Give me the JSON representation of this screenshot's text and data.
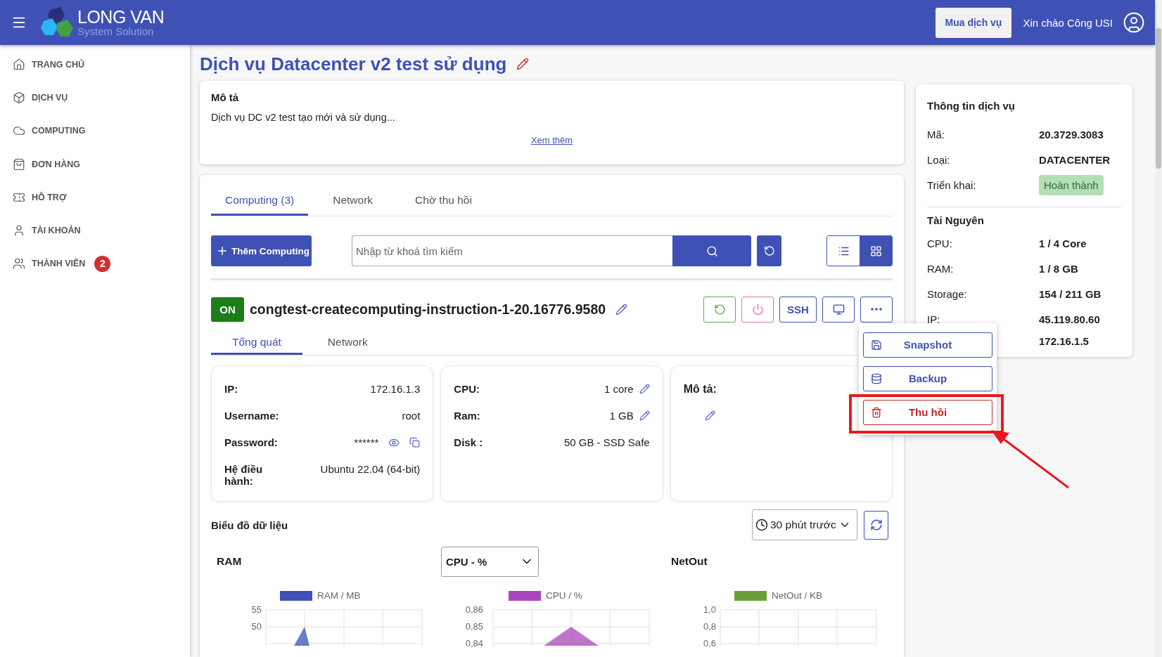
{
  "header": {
    "logo": {
      "name": "LONG VAN",
      "tagline": "System Solution"
    },
    "buy_button": "Mua dịch vụ",
    "greeting": "Xin chào Công USI"
  },
  "sidebar": {
    "items": [
      {
        "label": "TRANG CHỦ"
      },
      {
        "label": "DỊCH VỤ"
      },
      {
        "label": "COMPUTING"
      },
      {
        "label": "ĐƠN HÀNG"
      },
      {
        "label": "HỖ TRỢ"
      },
      {
        "label": "TÀI KHOẢN"
      },
      {
        "label": "THÀNH VIÊN",
        "badge": "2"
      }
    ]
  },
  "page": {
    "title": "Dịch vụ Datacenter v2 test sử dụng"
  },
  "description": {
    "heading": "Mô tả",
    "text": "Dịch vụ DC v2 test tạo mới và sử dụng...",
    "more_link": "Xem thêm"
  },
  "tabs": [
    {
      "label": "Computing (3)",
      "selected": true
    },
    {
      "label": "Network",
      "selected": false
    },
    {
      "label": "Chờ thu hồi",
      "selected": false
    }
  ],
  "toolbar": {
    "add_button": "Thêm Computing",
    "search": {
      "placeholder": "Nhập từ khoá tìm kiếm"
    },
    "view_modes": [
      {
        "kind": "list",
        "selected": false
      },
      {
        "kind": "grid",
        "selected": true
      }
    ]
  },
  "computing": {
    "status": "ON",
    "on": true,
    "name": "congtest-createcomputing-instruction-1-20.16776.9580",
    "actions": [
      {
        "kind": "restart"
      },
      {
        "kind": "power"
      },
      {
        "kind": "text",
        "label": "SSH"
      },
      {
        "kind": "console"
      },
      {
        "kind": "more"
      }
    ],
    "menu": {
      "open": true,
      "items": [
        {
          "kind": "snapshot",
          "label": "Snapshot",
          "highlighted": false
        },
        {
          "kind": "backup",
          "label": "Backup",
          "highlighted": false
        },
        {
          "kind": "revoke",
          "label": "Thu hồi",
          "highlighted": true
        }
      ]
    },
    "sub_tabs": [
      {
        "label": "Tổng quát",
        "selected": true
      },
      {
        "label": "Network",
        "selected": false
      }
    ],
    "cards": [
      {
        "kind": "fields",
        "rows": [
          {
            "kind": "plain",
            "label": "IP:",
            "value": "172.16.1.3"
          },
          {
            "kind": "plain",
            "label": "Username:",
            "value": "root"
          },
          {
            "kind": "secret",
            "label": "Password:",
            "value": "******"
          },
          {
            "kind": "plain",
            "label": "Hệ điều hành:",
            "value": "Ubuntu 22.04 (64-bit)"
          }
        ]
      },
      {
        "kind": "fields",
        "rows": [
          {
            "kind": "editable",
            "label": "CPU:",
            "value": "1 core"
          },
          {
            "kind": "editable",
            "label": "Ram:",
            "value": "1 GB"
          },
          {
            "kind": "plain",
            "label": "Disk :",
            "value": "50 GB - SSD Safe"
          }
        ]
      },
      {
        "kind": "note",
        "heading": "Mô tả:"
      }
    ]
  },
  "charts": {
    "title": "Biểu đồ dữ liệu",
    "range": "30 phút trước",
    "panels": [
      {
        "kind": "label",
        "title": "RAM",
        "legend": "RAM / MB",
        "color": "#3f51b5",
        "y_ticks": [
          "55",
          "50"
        ]
      },
      {
        "kind": "select",
        "title": "CPU - %",
        "legend": "CPU / %",
        "color": "#ab47bc",
        "y_ticks": [
          "0,86",
          "0,85",
          "0,84"
        ]
      },
      {
        "kind": "label",
        "title": "NetOut",
        "legend": "NetOut / KB",
        "color": "#689f38",
        "y_ticks": [
          "1,0",
          "0,8",
          "0,6"
        ]
      }
    ]
  },
  "service_info": {
    "heading": "Thông tin dịch vụ",
    "rows": [
      {
        "kind": "text",
        "label": "Mã:",
        "value": "20.3729.3083"
      },
      {
        "kind": "text",
        "label": "Loại:",
        "value": "DATACENTER"
      },
      {
        "kind": "badge",
        "label": "Triển khai:",
        "value": "Hoàn thành"
      }
    ],
    "resources_heading": "Tài Nguyên",
    "resources": [
      {
        "label": "CPU:",
        "value": "1 / 4 Core"
      },
      {
        "label": "RAM:",
        "value": "1 / 8 GB"
      },
      {
        "label": "Storage:",
        "value": "154 / 211 GB"
      },
      {
        "label": "IP:",
        "value": "45.119.80.60"
      },
      {
        "value": "172.16.1.5"
      }
    ]
  }
}
